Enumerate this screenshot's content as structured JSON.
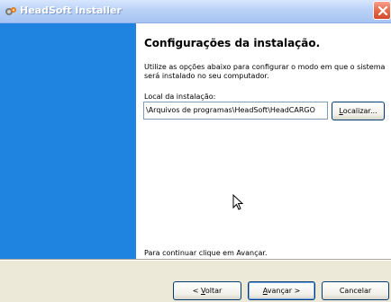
{
  "window": {
    "title": "HeadSoft Installer",
    "icons": {
      "app": "installer-icon",
      "close": "close-icon"
    }
  },
  "page": {
    "heading": "Configurações da instalação.",
    "description": "Utilize as opções abaixo para configurar o modo em que o sistema será instalado no seu computador.",
    "install_location_label": "Local da instalação:",
    "install_location_value": "\\Arquivos de programas\\HeadSoft\\HeadCARGO",
    "browse_button_prefix": "",
    "browse_button_access": "L",
    "browse_button_rest": "ocalizar...",
    "continue_hint": "Para continuar clique em Avançar."
  },
  "footer": {
    "back_prefix": "< ",
    "back_access": "V",
    "back_rest": "oltar",
    "next_prefix": "",
    "next_access": "A",
    "next_rest": "vançar >",
    "cancel_label": "Cancelar"
  },
  "colors": {
    "sidebar": "#1e84e0",
    "dialog_bg": "#ece9d8",
    "titlebar": "#b9d1f7",
    "close_button": "#e86a4e"
  }
}
